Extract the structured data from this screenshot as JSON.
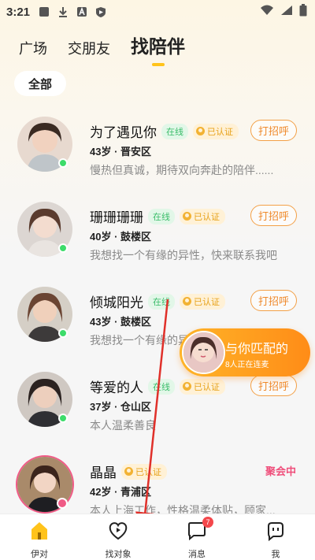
{
  "status_bar": {
    "time": "3:21"
  },
  "tabs": [
    {
      "label": "广场"
    },
    {
      "label": "交朋友"
    },
    {
      "label": "找陪伴",
      "active": true
    }
  ],
  "filter": {
    "label": "全部"
  },
  "list": [
    {
      "name": "为了遇见你",
      "online": "在线",
      "verified": "已认证",
      "greet": "打招呼",
      "age_location": "43岁 · 晋安区",
      "bio": "慢热但真诚，期待双向奔赴的陪伴......"
    },
    {
      "name": "珊珊珊珊",
      "online": "在线",
      "verified": "已认证",
      "greet": "打招呼",
      "age_location": "40岁 · 鼓楼区",
      "bio": "我想找一个有缘的异性，快来联系我吧"
    },
    {
      "name": "倾城阳光",
      "online": "在线",
      "verified": "已认证",
      "greet": "打招呼",
      "age_location": "43岁 · 鼓楼区",
      "bio": "我想找一个有缘的异性，快来联系我吧"
    },
    {
      "name": "等爱的人",
      "online": "在线",
      "verified": "已认证",
      "greet": "打招呼",
      "age_location": "37岁 · 仓山区",
      "bio": "本人温柔善良"
    },
    {
      "name": "晶晶",
      "verified": "已认证",
      "status": "聚会中",
      "age_location": "42岁 · 青浦区",
      "bio": "本人上海工作，性格温柔体贴，顾家..."
    }
  ],
  "match_banner": {
    "title": "与你匹配的",
    "subtitle": "8人正在连麦"
  },
  "bottom_nav": [
    {
      "label": "伊对"
    },
    {
      "label": "找对象"
    },
    {
      "label": "消息",
      "badge": "7"
    },
    {
      "label": "我"
    }
  ],
  "colors": {
    "accent": "#ffc31b",
    "greet": "#ef8a2c",
    "online": "#3ddc6a",
    "party": "#ef4f7b",
    "arrow": "#e0302a"
  }
}
